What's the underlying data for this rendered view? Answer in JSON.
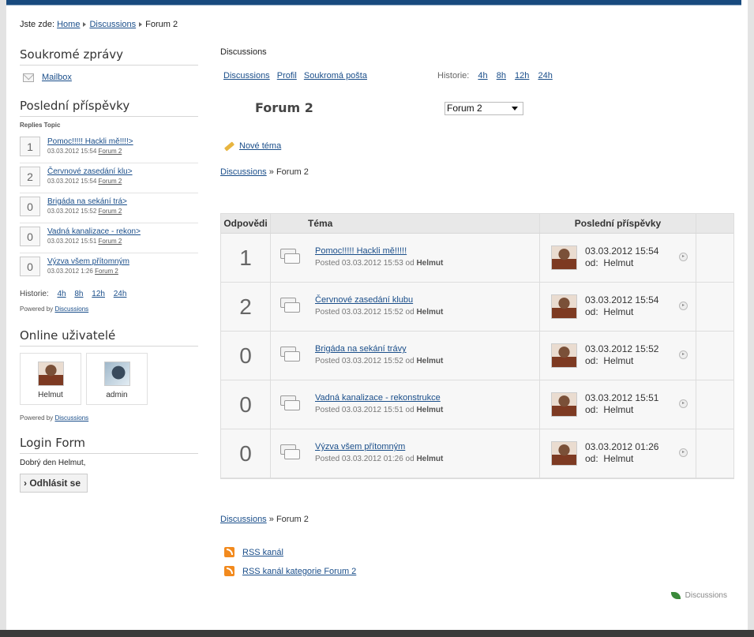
{
  "breadcrumb": {
    "prefix": "Jste zde:",
    "items": [
      "Home",
      "Discussions"
    ],
    "current": "Forum 2"
  },
  "private_messages": {
    "title": "Soukromé zprávy",
    "mailbox": "Mailbox"
  },
  "recent_posts": {
    "title": "Poslední příspěvky",
    "header": "Replies Topic",
    "items": [
      {
        "count": "1",
        "title": "Pomoc!!!!! Hackli mě!!!!>",
        "date": "03.03.2012 15:54",
        "forum": "Forum 2"
      },
      {
        "count": "2",
        "title": "Červnové zasedání klu>",
        "date": "03.03.2012 15:54",
        "forum": "Forum 2"
      },
      {
        "count": "0",
        "title": "Brigáda na sekání trá>",
        "date": "03.03.2012 15:52",
        "forum": "Forum 2"
      },
      {
        "count": "0",
        "title": "Vadná kanalizace - rekon>",
        "date": "03.03.2012 15:51",
        "forum": "Forum 2"
      },
      {
        "count": "0",
        "title": "Výzva všem přítomným",
        "date": "03.03.2012 1:26",
        "forum": "Forum 2"
      }
    ],
    "history_label": "Historie:",
    "history": [
      "4h",
      "8h",
      "12h",
      "24h"
    ],
    "powered_by": "Powered by",
    "powered_link": "Discussions"
  },
  "online_users": {
    "title": "Online uživatelé",
    "users": [
      {
        "name": "Helmut"
      },
      {
        "name": "admin"
      }
    ],
    "powered_by": "Powered by",
    "powered_link": "Discussions"
  },
  "login": {
    "title": "Login Form",
    "greeting": "Dobrý den Helmut,",
    "logout": "Odhlásit se"
  },
  "main": {
    "title": "Discussions",
    "nav": [
      "Discussions",
      "Profil",
      "Soukromá pošta"
    ],
    "history_label": "Historie:",
    "history": [
      "4h",
      "8h",
      "12h",
      "24h"
    ],
    "forum_name": "Forum 2",
    "forum_select": "Forum 2",
    "new_topic": "Nové téma",
    "crumb_link": "Discussions",
    "crumb_sep": "»",
    "crumb_current": "Forum 2",
    "table": {
      "headers": {
        "replies": "Odpovědi",
        "topic": "Téma",
        "last": "Poslední příspěvky"
      },
      "rows": [
        {
          "count": "1",
          "title": "Pomoc!!!!! Hackli mě!!!!!",
          "posted": "Posted 03.03.2012 15:53 od",
          "author": "Helmut",
          "last_date": "03.03.2012 15:54",
          "last_by_label": "od:",
          "last_by": "Helmut"
        },
        {
          "count": "2",
          "title": "Červnové zasedání klubu",
          "posted": "Posted 03.03.2012 15:52 od",
          "author": "Helmut",
          "last_date": "03.03.2012 15:54",
          "last_by_label": "od:",
          "last_by": "Helmut"
        },
        {
          "count": "0",
          "title": "Brigáda na sekání trávy",
          "posted": "Posted 03.03.2012 15:52 od",
          "author": "Helmut",
          "last_date": "03.03.2012 15:52",
          "last_by_label": "od:",
          "last_by": "Helmut"
        },
        {
          "count": "0",
          "title": "Vadná kanalizace - rekonstrukce",
          "posted": "Posted 03.03.2012 15:51 od",
          "author": "Helmut",
          "last_date": "03.03.2012 15:51",
          "last_by_label": "od:",
          "last_by": "Helmut"
        },
        {
          "count": "0",
          "title": "Výzva všem přítomným",
          "posted": "Posted 03.03.2012 01:26 od",
          "author": "Helmut",
          "last_date": "03.03.2012 01:26",
          "last_by_label": "od:",
          "last_by": "Helmut"
        }
      ]
    },
    "rss": [
      "RSS kanál",
      "RSS kanál kategorie Forum 2"
    ],
    "footer_brand": "Discussions"
  }
}
